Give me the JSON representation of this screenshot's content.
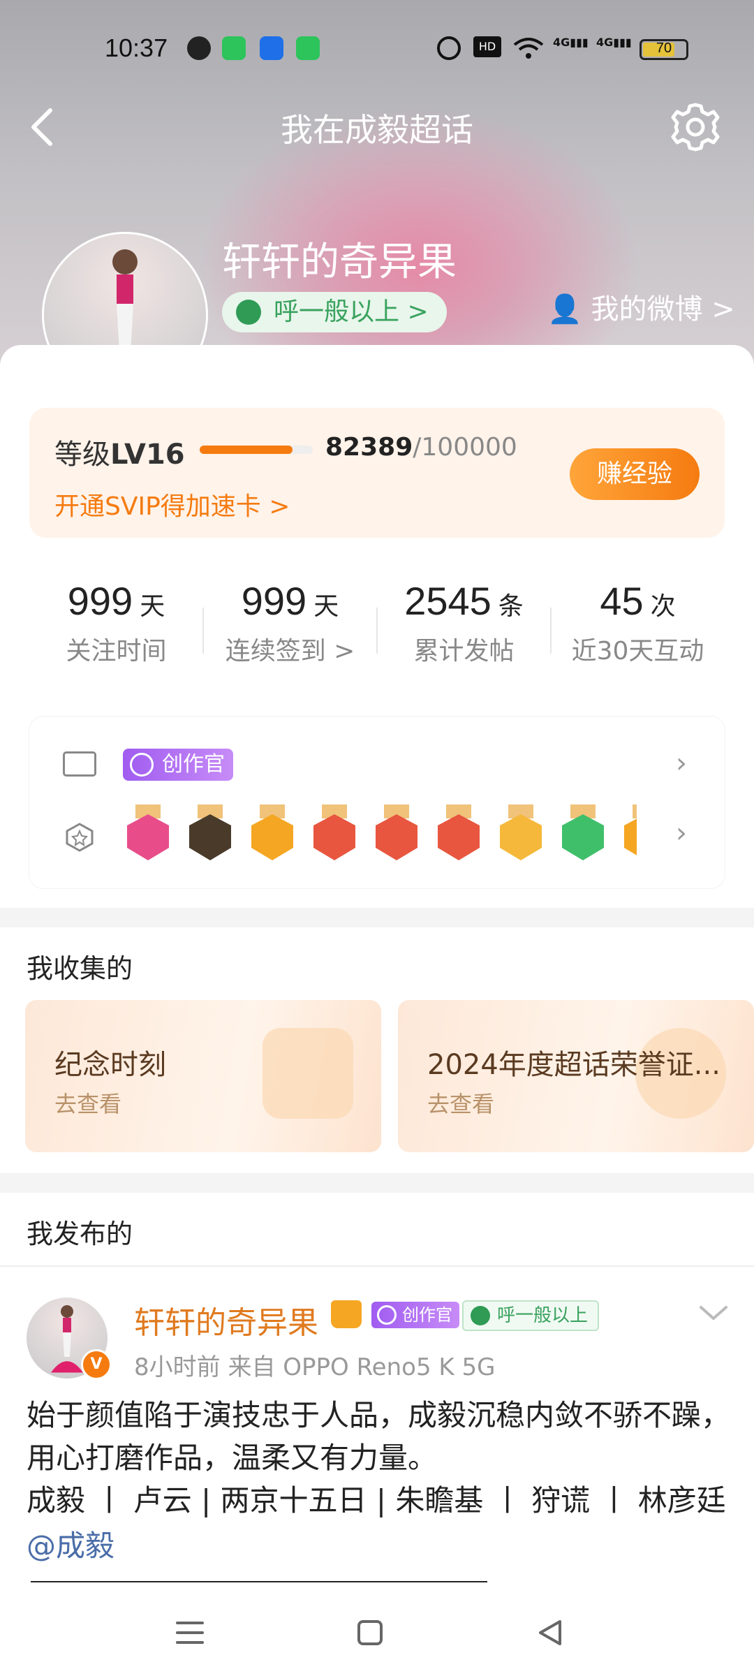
{
  "status_bar": {
    "time": "10:37",
    "battery": "70",
    "network": "HD",
    "signal_labels": [
      "4G",
      "4G"
    ]
  },
  "nav": {
    "title": "我在成毅超话"
  },
  "profile": {
    "name": "轩轩的奇异果",
    "tag": "呼一般以上 >",
    "verified_badge": "V",
    "my_weibo": "我的微博 >"
  },
  "level": {
    "label": "等级",
    "value": "LV16",
    "progress": 0.82389,
    "points_current": "82389",
    "points_total": "/100000",
    "svip": "开通SVIP得加速卡 >",
    "earn_button": "赚经验"
  },
  "stats": [
    {
      "num": "999",
      "unit": "天",
      "label": "关注时间"
    },
    {
      "num": "999",
      "unit": "天",
      "label": "连续签到 >"
    },
    {
      "num": "2545",
      "unit": "条",
      "label": "累计发帖"
    },
    {
      "num": "45",
      "unit": "次",
      "label": "近30天互动"
    }
  ],
  "badges": {
    "creator_label": "创作官",
    "medals": [
      "LV16",
      "SUPER",
      "crown",
      "cat-1",
      "cat-2",
      "cat-3",
      "hi",
      "hand",
      "partial"
    ]
  },
  "collected": {
    "title": "我收集的",
    "items": [
      {
        "title": "纪念时刻",
        "sub": "去查看"
      },
      {
        "title": "2024年度超话荣誉证...",
        "sub": "去查看"
      }
    ]
  },
  "published": {
    "title": "我发布的",
    "post": {
      "author": "轩轩的奇异果",
      "creator_label": "创作官",
      "tag": "呼一般以上",
      "verified_badge": "V",
      "meta": "8小时前  来自 OPPO Reno5 K 5G",
      "body": "始于颜值陷于演技忠于人品，成毅沉稳内敛不骄不躁，用心打磨作品，温柔又有力量。\n成毅 丨 卢云 | 两京十五日 | 朱瞻基  丨 狩谎 丨 林彦廷",
      "mention": "@成毅"
    }
  },
  "colors": {
    "accent": "#f57b10",
    "green": "#3aa25e",
    "purple": "#a05cf0",
    "link": "#4a6da8"
  }
}
